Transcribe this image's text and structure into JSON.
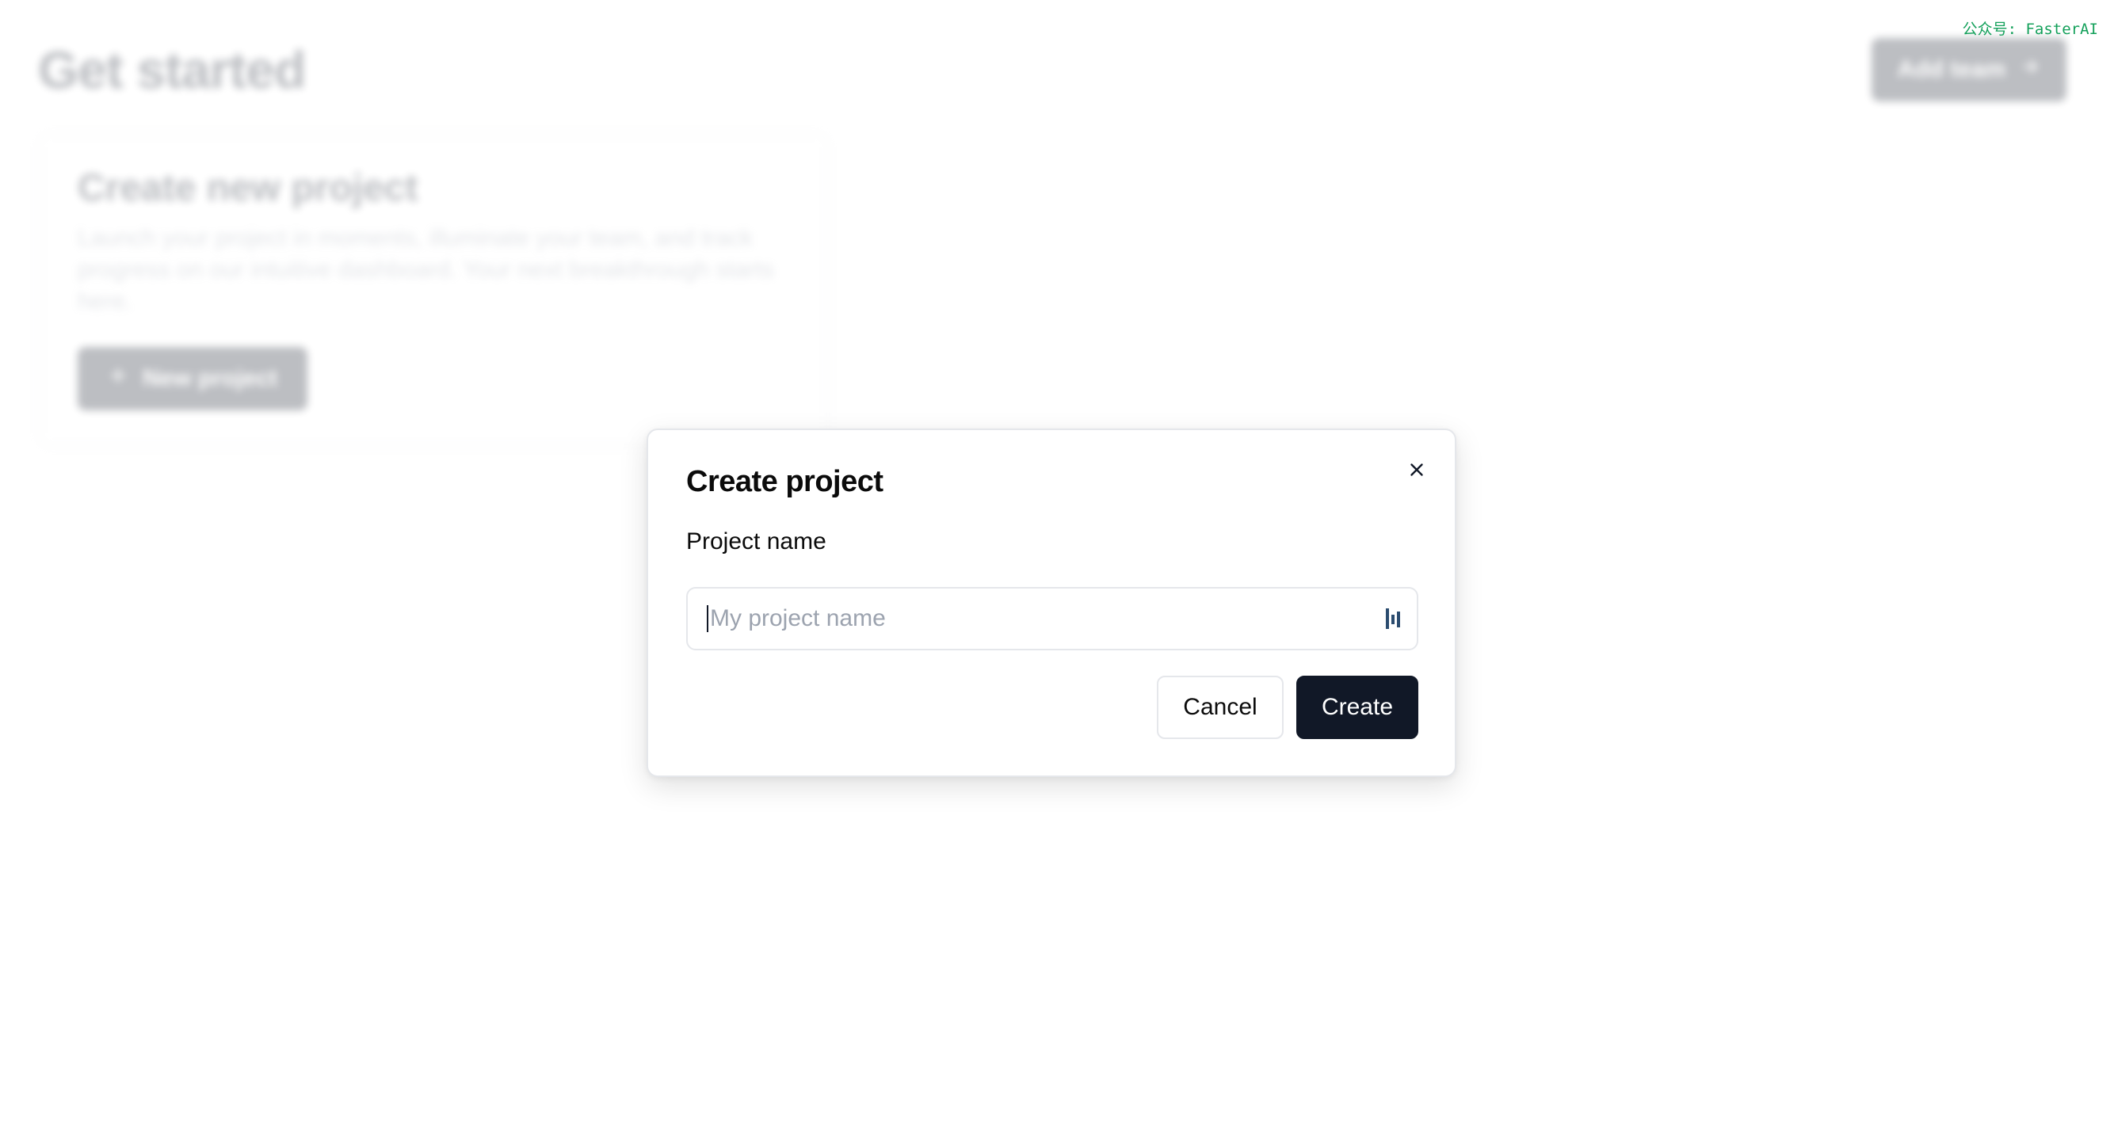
{
  "background": {
    "page_title": "Get started",
    "header_button_label": "Add team",
    "card": {
      "title": "Create new project",
      "description": "Launch your project in moments, illuminate your team, and track progress on our intuitive dashboard. Your next breakthrough starts here.",
      "button_label": "New project"
    }
  },
  "watermark": "公众号: FasterAI",
  "modal": {
    "title": "Create project",
    "close_icon": "close-icon",
    "field_label": "Project name",
    "input_value": "",
    "input_placeholder": "My project name",
    "input_extension_icon": "password-manager-icon",
    "cancel_label": "Cancel",
    "create_label": "Create"
  },
  "colors": {
    "primary": "#111827",
    "border": "#e5e7eb",
    "placeholder": "#9ca3af",
    "watermark": "#13a05a",
    "extension_icon": "#2b4c6f"
  }
}
